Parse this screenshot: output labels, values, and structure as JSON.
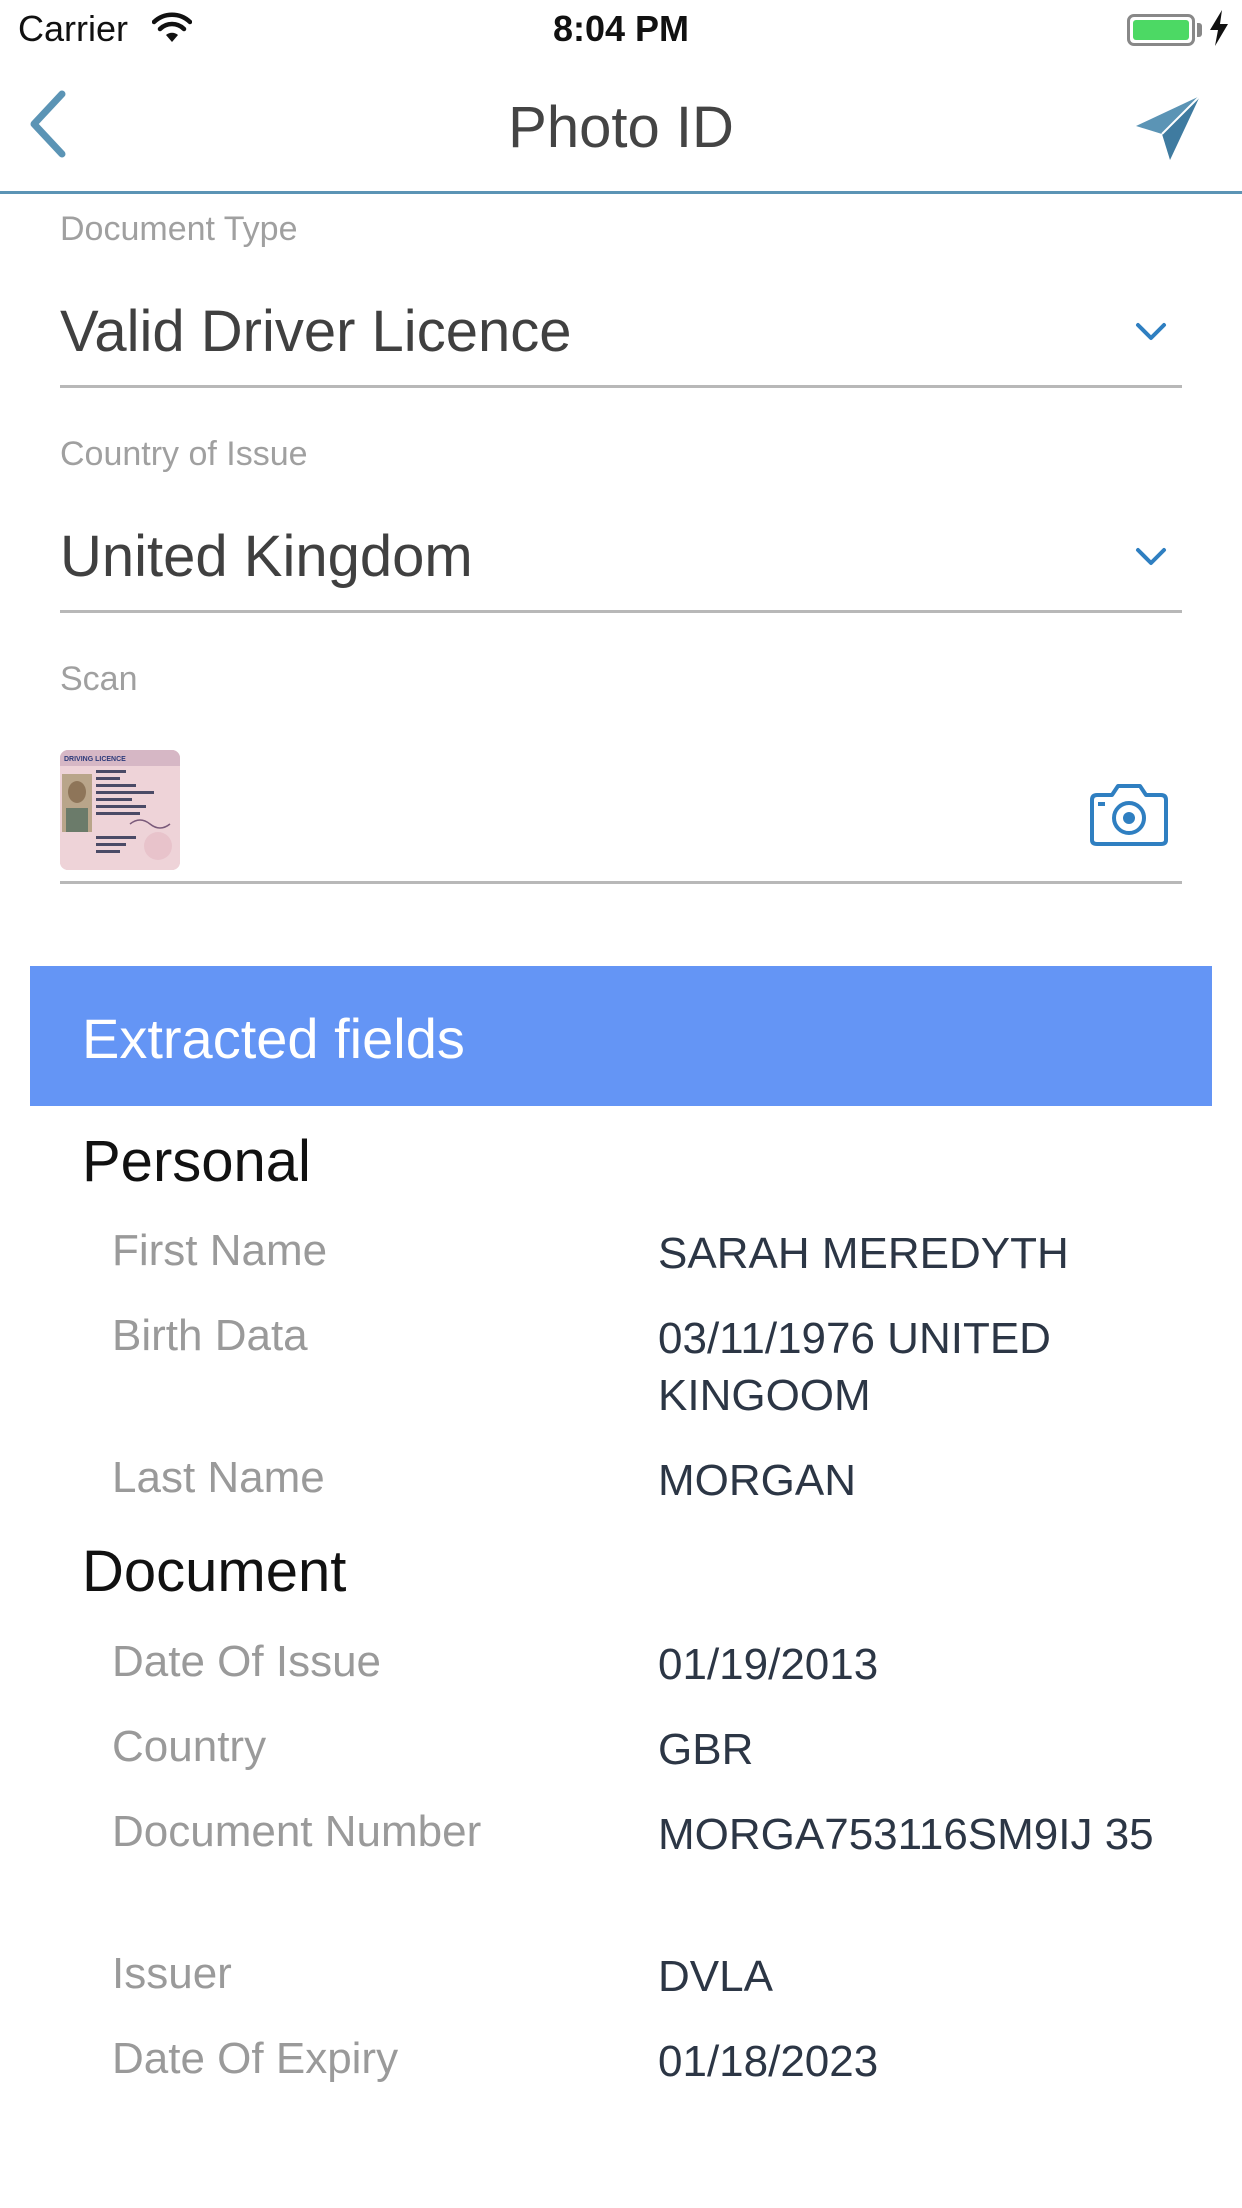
{
  "status_bar": {
    "carrier": "Carrier",
    "time": "8:04 PM",
    "battery_level": 1.0,
    "battery_color": "#4cd964",
    "icons": [
      "wifi-icon",
      "battery-icon",
      "charging-bolt-icon"
    ]
  },
  "nav": {
    "title": "Photo ID",
    "back_icon": "chevron-left-icon",
    "send_icon": "paper-plane-icon",
    "accent_color": "#5b94b5"
  },
  "form": {
    "document_type": {
      "label": "Document Type",
      "value": "Valid Driver Licence"
    },
    "country_of_issue": {
      "label": "Country of Issue",
      "value": "United Kingdom"
    },
    "scan": {
      "label": "Scan",
      "camera_icon": "camera-icon",
      "thumbnail_text": "DRIVING LICENCE"
    },
    "chevron_color": "#2f7fc1"
  },
  "extracted": {
    "title": "Extracted fields",
    "header_color": "#6495f5",
    "sections": [
      {
        "title": "Personal",
        "rows": [
          {
            "label": "First Name",
            "value": "SARAH MEREDYTH"
          },
          {
            "label": "Birth Data",
            "value": "03/11/1976 UNITED KINGOOM"
          },
          {
            "label": "Last Name",
            "value": "MORGAN"
          }
        ]
      },
      {
        "title": "Document",
        "rows": [
          {
            "label": "Date Of Issue",
            "value": "01/19/2013"
          },
          {
            "label": "Country",
            "value": "GBR"
          },
          {
            "label": "Document Number",
            "value": "MORGA753116SM9IJ 35"
          },
          {
            "label": "Issuer",
            "value": "DVLA"
          },
          {
            "label": "Date Of Expiry",
            "value": "01/18/2023"
          }
        ]
      }
    ]
  }
}
